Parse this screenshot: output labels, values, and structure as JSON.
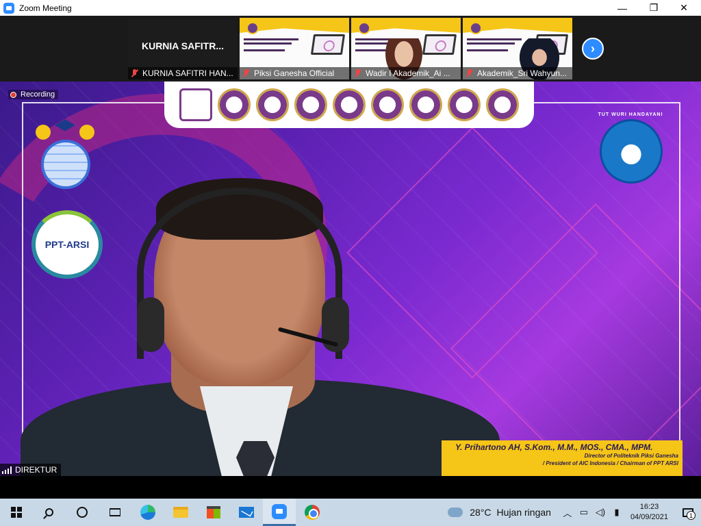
{
  "window": {
    "title": "Zoom Meeting",
    "minimize": "—",
    "restore": "❐",
    "close": "✕"
  },
  "filmstrip": {
    "tiles": [
      {
        "big_name": "KURNIA SAFITR...",
        "label": "KURNIA SAFITRI HAN..."
      },
      {
        "label": "Piksi Ganesha Official"
      },
      {
        "label": "Wadir I Akademik_Ai ..."
      },
      {
        "label": "Akademik_Sri Wahyun..."
      }
    ],
    "next_arrow": "›"
  },
  "stage": {
    "recording": "Recording",
    "ppt_logo": "PPT-ARSI",
    "tut_wuri": "TUT WURI HANDAYANI",
    "speaker_name": "Y. Prihartono AH, S.Kom., M.M., MOS., CMA., MPM.",
    "speaker_role_1": "Director of Politeknik Piksi Ganesha",
    "speaker_role_2": "/ President of AIC Indonesia / Chairman of PPT ARSI",
    "name_tag": "DIREKTUR"
  },
  "taskbar": {
    "temperature": "28°C",
    "weather": "Hujan ringan",
    "time": "16:23",
    "date": "04/09/2021",
    "notifications": "1"
  }
}
